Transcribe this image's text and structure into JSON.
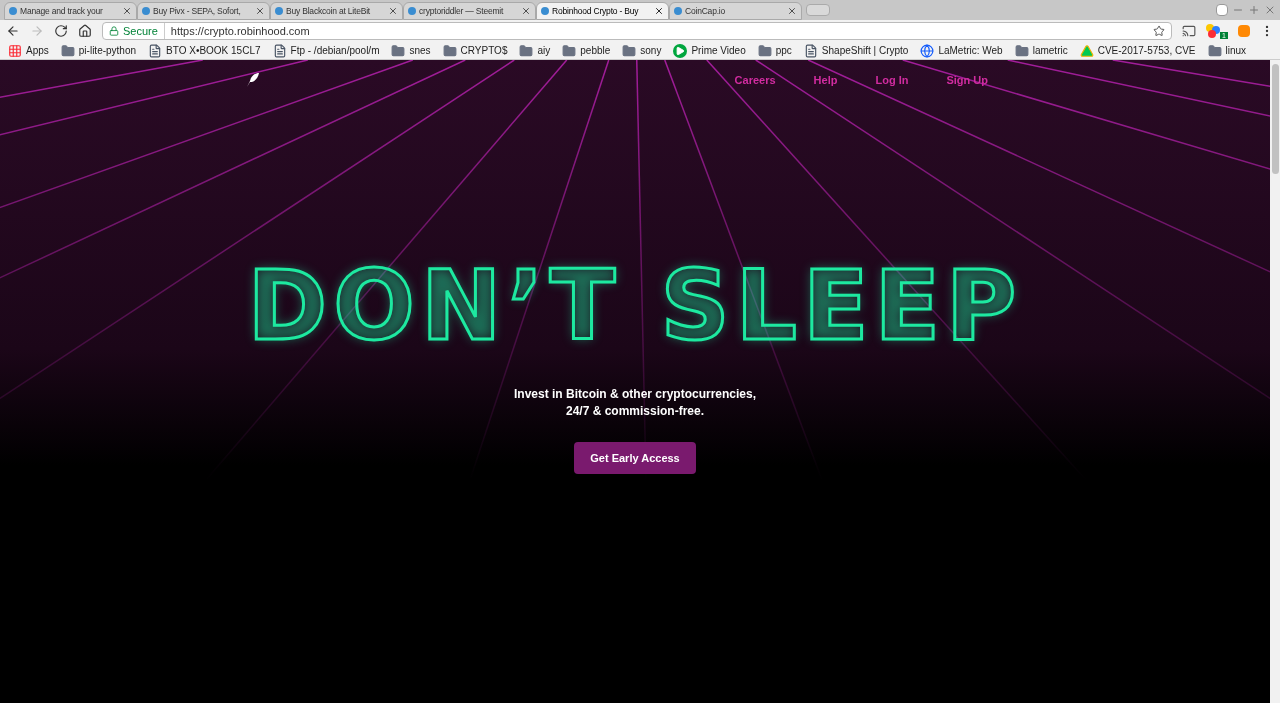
{
  "tabs": [
    {
      "title": "Manage and track your",
      "selected": false
    },
    {
      "title": "Buy Pivx - SEPA, Sofort,",
      "selected": false
    },
    {
      "title": "Buy Blackcoin at LiteBit",
      "selected": false
    },
    {
      "title": "cryptoriddler — Steemit",
      "selected": false
    },
    {
      "title": "Robinhood Crypto - Buy",
      "selected": true
    },
    {
      "title": "CoinCap.io",
      "selected": false
    }
  ],
  "address_bar": {
    "security": "Secure",
    "url": "https://crypto.robinhood.com"
  },
  "bookmarks": [
    {
      "label": "Apps",
      "kind": "apps"
    },
    {
      "label": "pi-lite-python",
      "kind": "folder"
    },
    {
      "label": "BTO X•BOOK 15CL7",
      "kind": "page"
    },
    {
      "label": "Ftp - /debian/pool/m",
      "kind": "page"
    },
    {
      "label": "snes",
      "kind": "folder"
    },
    {
      "label": "CRYPTO$",
      "kind": "folder"
    },
    {
      "label": "aiy",
      "kind": "folder"
    },
    {
      "label": "pebble",
      "kind": "folder"
    },
    {
      "label": "sony",
      "kind": "folder"
    },
    {
      "label": "Prime Video",
      "kind": "play"
    },
    {
      "label": "ppc",
      "kind": "folder"
    },
    {
      "label": "ShapeShift | Crypto",
      "kind": "page"
    },
    {
      "label": "LaMetric: Web",
      "kind": "globe"
    },
    {
      "label": "lametric",
      "kind": "folder"
    },
    {
      "label": "CVE-2017-5753, CVE",
      "kind": "drive"
    },
    {
      "label": "linux",
      "kind": "folder"
    }
  ],
  "extension_badge": "1",
  "nav": [
    "Careers",
    "Help",
    "Log In",
    "Sign Up"
  ],
  "hero": {
    "title": "DON’T SLEEP",
    "subtitle_lines": [
      "Invest in Bitcoin & other cryptocurrencies,",
      "24/7 & commission-free."
    ],
    "button": "Get Early Access"
  }
}
